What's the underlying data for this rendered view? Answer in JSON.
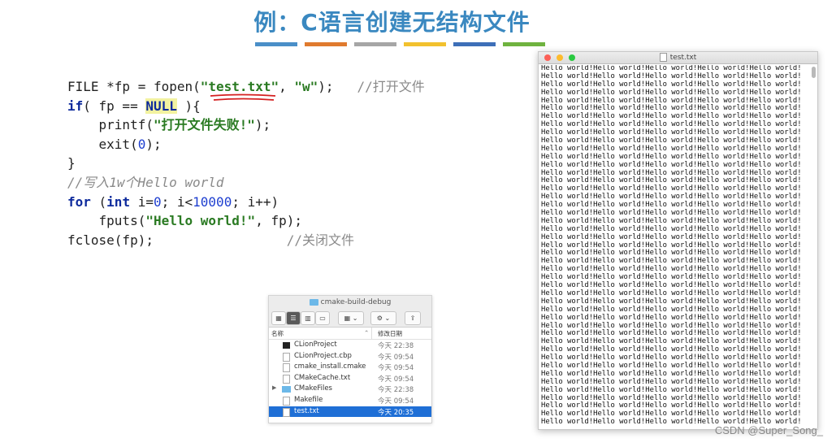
{
  "slide": {
    "title": "例：C语言创建无结构文件",
    "color_bars": [
      "#4a8fc8",
      "#e07a2e",
      "#a6a6a6",
      "#f2c12e",
      "#3d6fb8",
      "#6fb33f"
    ]
  },
  "code": {
    "line1": {
      "a": "FILE *fp = fopen(",
      "b": "\"test.txt\"",
      "c": ", ",
      "d": "\"w\"",
      "e": ");   ",
      "f": "//打开文件"
    },
    "line2": {
      "a": "if",
      "b": "( fp == ",
      "c": "NULL",
      "d": " ){"
    },
    "line3": {
      "a": "    printf(",
      "b": "\"打开文件失败!\"",
      "c": ");"
    },
    "line4": {
      "a": "    exit(",
      "b": "0",
      "c": ");"
    },
    "line5": {
      "a": "}"
    },
    "line6": {
      "a": "//写入1w个Hello world"
    },
    "line7": {
      "a": "for",
      "b": " (",
      "c": "int",
      "d": " i=",
      "e": "0",
      "f": "; i<",
      "g": "10000",
      "h": "; i++)"
    },
    "line8": {
      "a": "    fputs(",
      "b": "\"Hello world!\"",
      "c": ", fp);"
    },
    "line9": {
      "a": "fclose(fp);                 ",
      "b": "//关闭文件"
    }
  },
  "finder": {
    "window_title": "cmake-build-debug",
    "col_name": "名称",
    "col_date": "修改日期",
    "files": [
      {
        "name": "CLionProject",
        "date": "今天 22:38",
        "icon": "executable-icon"
      },
      {
        "name": "CLionProject.cbp",
        "date": "今天 09:54",
        "icon": "document-icon"
      },
      {
        "name": "cmake_install.cmake",
        "date": "今天 09:54",
        "icon": "document-icon"
      },
      {
        "name": "CMakeCache.txt",
        "date": "今天 09:54",
        "icon": "document-icon"
      },
      {
        "name": "CMakeFiles",
        "date": "今天 22:38",
        "icon": "folder-icon"
      },
      {
        "name": "Makefile",
        "date": "今天 09:54",
        "icon": "document-icon"
      },
      {
        "name": "test.txt",
        "date": "今天 20:35",
        "icon": "document-icon",
        "selected": true
      }
    ]
  },
  "editor": {
    "window_title": "test.txt",
    "line_text": "Hello world!Hello world!Hello world!Hello world!Hello world!",
    "line_count": 45
  },
  "watermark": "CSDN @Super_Song_"
}
